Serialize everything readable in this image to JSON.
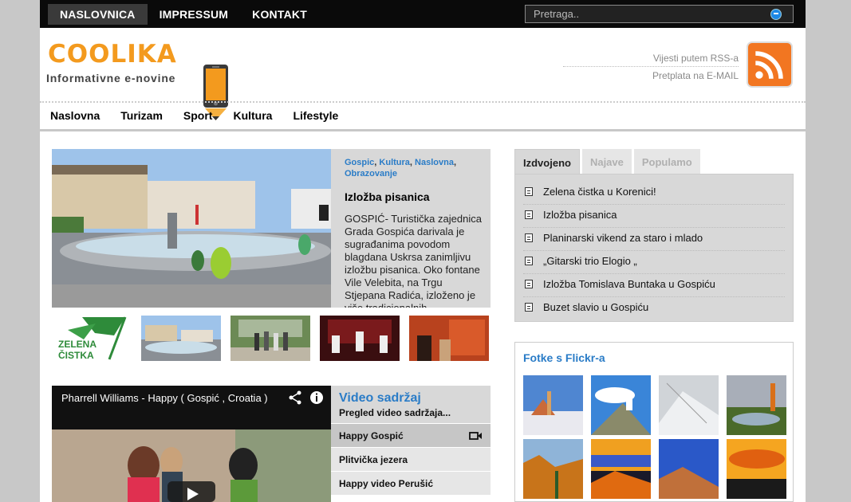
{
  "topnav": {
    "items": [
      "NASLOVNICA",
      "IMPRESSUM",
      "KONTAKT"
    ],
    "search_placeholder": "Pretraga.."
  },
  "header": {
    "logo": "COOLIKA",
    "tagline": "Informativne e-novine",
    "rss_text": "Vijesti putem RSS-a",
    "email_text": "Pretplata na E-MAIL"
  },
  "mainnav": [
    "Naslovna",
    "Turizam",
    "Sport",
    "Kultura",
    "Lifestyle"
  ],
  "featured": {
    "categories": [
      "Gospic",
      "Kultura",
      "Naslovna",
      "Obrazovanje"
    ],
    "title": "Izložba pisanica",
    "body": "  GOSPIĆ- Turistička zajednica Grada Gospića darivala je sugrađanima povodom blagdana Uskrsa zanimljivu izložbu  pisanica. Oko fontane Vile Velebita, na Trgu Stjepana Radića, izloženo je više tradicionalnih"
  },
  "thumb_logo": {
    "line1": "ZELENA",
    "line2": "ČISTKA"
  },
  "video": {
    "title": "Pharrell Williams - Happy ( Gospić , Croatia )"
  },
  "video_list": {
    "title": "Video sadržaj",
    "subtitle": "Pregled video sadržaja...",
    "items": [
      "Happy Gospić",
      "Plitvička jezera",
      "Happy video Perušić"
    ]
  },
  "tabs": [
    "Izdvojeno",
    "Najave",
    "Populamo"
  ],
  "tab_items": [
    "Zelena čistka u Korenici!",
    "Izložba pisanica",
    "Planinarski vikend za staro i mlado",
    "„Gitarski trio Elogio „",
    "Izložba Tomislava Buntaka u Gospiću",
    "Buzet slavio u Gospiću"
  ],
  "flickr": {
    "title": "Fotke s Flickr-a"
  },
  "colors": {
    "accent": "#2a7cc7",
    "brand": "#f39a1e",
    "rss": "#f27621"
  }
}
